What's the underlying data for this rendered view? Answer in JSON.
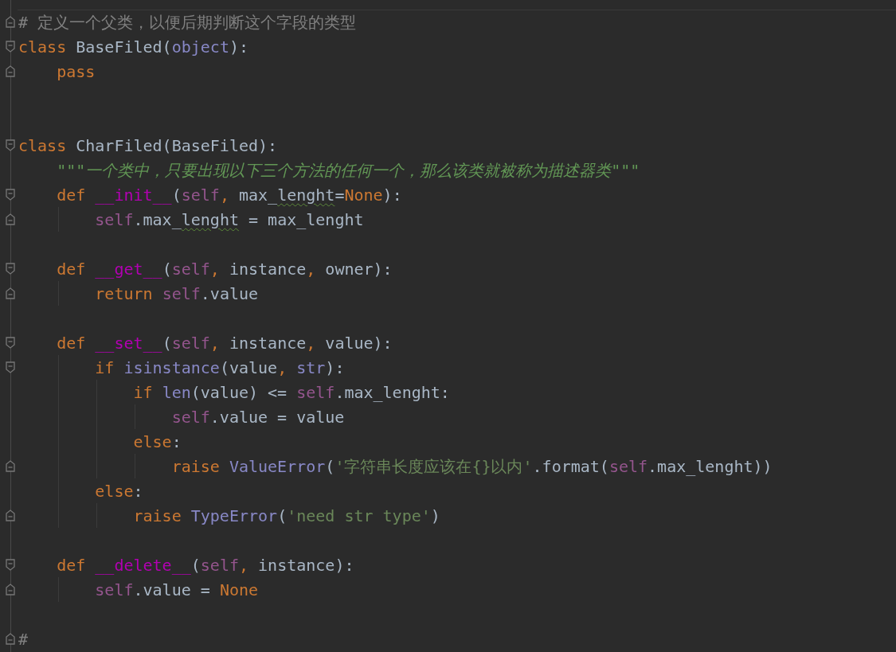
{
  "editor": {
    "lines": [
      {
        "kind": "fold-end",
        "tokens": [
          {
            "kind": "comment",
            "text": "# 定义一个父类，以便后期判断这个字段的类型"
          }
        ]
      },
      {
        "kind": "fold-start",
        "tokens": [
          {
            "kind": "keyword",
            "text": "class "
          },
          {
            "kind": "plain",
            "text": "BaseFiled("
          },
          {
            "kind": "builtin",
            "text": "object"
          },
          {
            "kind": "plain",
            "text": "):"
          }
        ]
      },
      {
        "kind": "fold-end",
        "tokens": [
          {
            "kind": "keyword",
            "text": "    pass"
          }
        ]
      },
      {
        "kind": "blank"
      },
      {
        "kind": "blank"
      },
      {
        "kind": "fold-start",
        "tokens": [
          {
            "kind": "keyword",
            "text": "class "
          },
          {
            "kind": "plain",
            "text": "CharFiled(BaseFiled):"
          }
        ]
      },
      {
        "kind": "plain",
        "tokens": [
          {
            "kind": "docstring",
            "text": "    \"\"\"一个类中，只要出现以下三个方法的任何一个，那么该类就被称为描述器类\"\"\""
          }
        ]
      },
      {
        "kind": "fold-start",
        "tokens": [
          {
            "kind": "keyword",
            "text": "    def "
          },
          {
            "kind": "magic",
            "text": "__init__"
          },
          {
            "kind": "plain",
            "text": "("
          },
          {
            "kind": "self",
            "text": "self"
          },
          {
            "kind": "keyword",
            "text": ", "
          },
          {
            "kind": "plain",
            "text": "max_"
          },
          {
            "kind": "typo",
            "text": "lenght"
          },
          {
            "kind": "plain",
            "text": "="
          },
          {
            "kind": "keyword",
            "text": "None"
          },
          {
            "kind": "plain",
            "text": "):"
          }
        ]
      },
      {
        "kind": "fold-end",
        "tokens": [
          {
            "kind": "self",
            "text": "        self"
          },
          {
            "kind": "plain",
            "text": ".max_"
          },
          {
            "kind": "typo",
            "text": "lenght"
          },
          {
            "kind": "plain",
            "text": " = max_lenght"
          }
        ]
      },
      {
        "kind": "blank"
      },
      {
        "kind": "fold-start",
        "tokens": [
          {
            "kind": "keyword",
            "text": "    def "
          },
          {
            "kind": "magic",
            "text": "__get__"
          },
          {
            "kind": "plain",
            "text": "("
          },
          {
            "kind": "self",
            "text": "self"
          },
          {
            "kind": "keyword",
            "text": ", "
          },
          {
            "kind": "plain",
            "text": "instance"
          },
          {
            "kind": "keyword",
            "text": ", "
          },
          {
            "kind": "plain",
            "text": "owner):"
          }
        ]
      },
      {
        "kind": "fold-end",
        "tokens": [
          {
            "kind": "keyword",
            "text": "        return "
          },
          {
            "kind": "self",
            "text": "self"
          },
          {
            "kind": "plain",
            "text": ".value"
          }
        ]
      },
      {
        "kind": "blank"
      },
      {
        "kind": "fold-start",
        "tokens": [
          {
            "kind": "keyword",
            "text": "    def "
          },
          {
            "kind": "magic",
            "text": "__set__"
          },
          {
            "kind": "plain",
            "text": "("
          },
          {
            "kind": "self",
            "text": "self"
          },
          {
            "kind": "keyword",
            "text": ", "
          },
          {
            "kind": "plain",
            "text": "instance"
          },
          {
            "kind": "keyword",
            "text": ", "
          },
          {
            "kind": "plain",
            "text": "value):"
          }
        ]
      },
      {
        "kind": "fold-start",
        "tokens": [
          {
            "kind": "keyword",
            "text": "        if "
          },
          {
            "kind": "builtin",
            "text": "isinstance"
          },
          {
            "kind": "plain",
            "text": "(value"
          },
          {
            "kind": "keyword",
            "text": ", "
          },
          {
            "kind": "builtin",
            "text": "str"
          },
          {
            "kind": "plain",
            "text": "):"
          }
        ]
      },
      {
        "kind": "plain",
        "tokens": [
          {
            "kind": "keyword",
            "text": "            if "
          },
          {
            "kind": "builtin",
            "text": "len"
          },
          {
            "kind": "plain",
            "text": "(value) <= "
          },
          {
            "kind": "self",
            "text": "self"
          },
          {
            "kind": "plain",
            "text": ".max_lenght:"
          }
        ]
      },
      {
        "kind": "plain",
        "tokens": [
          {
            "kind": "self",
            "text": "                self"
          },
          {
            "kind": "plain",
            "text": ".value = value"
          }
        ]
      },
      {
        "kind": "plain",
        "tokens": [
          {
            "kind": "keyword",
            "text": "            else"
          },
          {
            "kind": "plain",
            "text": ":"
          }
        ]
      },
      {
        "kind": "fold-end",
        "tokens": [
          {
            "kind": "keyword",
            "text": "                raise "
          },
          {
            "kind": "builtin",
            "text": "ValueError"
          },
          {
            "kind": "plain",
            "text": "("
          },
          {
            "kind": "string",
            "text": "'字符串长度应该在{}以内'"
          },
          {
            "kind": "plain",
            "text": ".format("
          },
          {
            "kind": "self",
            "text": "self"
          },
          {
            "kind": "plain",
            "text": ".max_lenght))"
          }
        ]
      },
      {
        "kind": "plain",
        "tokens": [
          {
            "kind": "keyword",
            "text": "        else"
          },
          {
            "kind": "plain",
            "text": ":"
          }
        ]
      },
      {
        "kind": "fold-end",
        "tokens": [
          {
            "kind": "keyword",
            "text": "            raise "
          },
          {
            "kind": "builtin",
            "text": "TypeError"
          },
          {
            "kind": "plain",
            "text": "("
          },
          {
            "kind": "string",
            "text": "'need str type'"
          },
          {
            "kind": "plain",
            "text": ")"
          }
        ]
      },
      {
        "kind": "blank"
      },
      {
        "kind": "fold-start",
        "tokens": [
          {
            "kind": "keyword",
            "text": "    def "
          },
          {
            "kind": "magic",
            "text": "__delete__"
          },
          {
            "kind": "plain",
            "text": "("
          },
          {
            "kind": "self",
            "text": "self"
          },
          {
            "kind": "keyword",
            "text": ", "
          },
          {
            "kind": "plain",
            "text": "instance):"
          }
        ]
      },
      {
        "kind": "fold-end",
        "tokens": [
          {
            "kind": "self",
            "text": "        self"
          },
          {
            "kind": "plain",
            "text": ".value = "
          },
          {
            "kind": "keyword",
            "text": "None"
          }
        ]
      },
      {
        "kind": "blank"
      },
      {
        "kind": "fold-end",
        "tokens": [
          {
            "kind": "comment",
            "text": "#"
          }
        ]
      }
    ]
  }
}
